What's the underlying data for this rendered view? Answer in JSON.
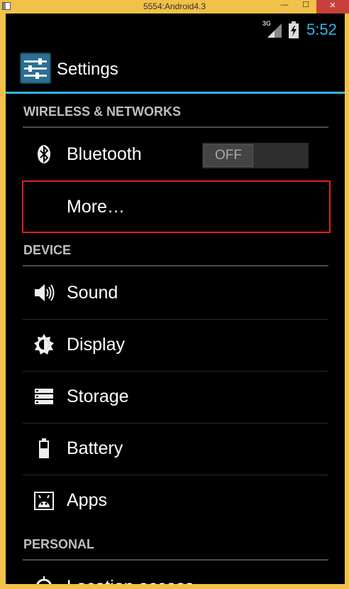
{
  "window": {
    "title": "5554:Android4.3",
    "minimize_label": "—",
    "maximize_label": "☐",
    "close_label": "✕"
  },
  "statusbar": {
    "network": "3G",
    "time": "5:52",
    "accent_color": "#33b5e5"
  },
  "actionbar": {
    "title": "Settings",
    "icon": "settings-sliders-icon"
  },
  "sections": {
    "wireless": {
      "header": "WIRELESS & NETWORKS",
      "bluetooth": {
        "label": "Bluetooth",
        "icon": "bluetooth-icon",
        "toggle": "OFF"
      },
      "more": {
        "label": "More…"
      }
    },
    "device": {
      "header": "DEVICE",
      "sound": {
        "label": "Sound",
        "icon": "speaker-icon"
      },
      "display": {
        "label": "Display",
        "icon": "brightness-icon"
      },
      "storage": {
        "label": "Storage",
        "icon": "storage-icon"
      },
      "battery": {
        "label": "Battery",
        "icon": "battery-icon"
      },
      "apps": {
        "label": "Apps",
        "icon": "apps-icon"
      }
    },
    "personal": {
      "header": "PERSONAL",
      "location": {
        "label": "Location access",
        "icon": "location-icon"
      }
    }
  },
  "highlight_color": "#e02020"
}
